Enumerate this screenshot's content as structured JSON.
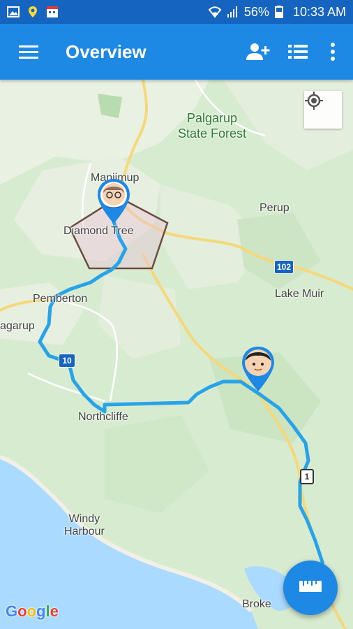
{
  "status_bar": {
    "battery": "56%",
    "time": "10:33 AM"
  },
  "app_bar": {
    "menu_icon": "hamburger-menu-icon",
    "title": "Overview",
    "add_person_icon": "add-person-icon",
    "list_icon": "list-icon",
    "more_icon": "more-vertical-icon"
  },
  "map": {
    "places": {
      "palgarup_state_forest_line1": "Palgarup",
      "palgarup_state_forest_line2": "State Forest",
      "manjimup": "Manjimup",
      "perup": "Perup",
      "diamond_tree": "Diamond Tree",
      "pemberton": "Pemberton",
      "lake_muir": "Lake Muir",
      "palgarup_left": "agarup",
      "northcliffe": "Northcliffe",
      "windy_harbour_line1": "Windy",
      "windy_harbour_line2": "Harbour",
      "broke": "Broke"
    },
    "road_shields": {
      "r102": "102",
      "r10": "10",
      "r1": "1"
    },
    "google_logo": "Google",
    "colors": {
      "route": "#29a3e8",
      "app_bar": "#1e88e5",
      "status_bar": "#1565c0",
      "geofence_border": "#6d4c41"
    }
  },
  "buttons": {
    "my_location_icon": "my-location-icon",
    "measure_icon": "ruler-icon"
  }
}
